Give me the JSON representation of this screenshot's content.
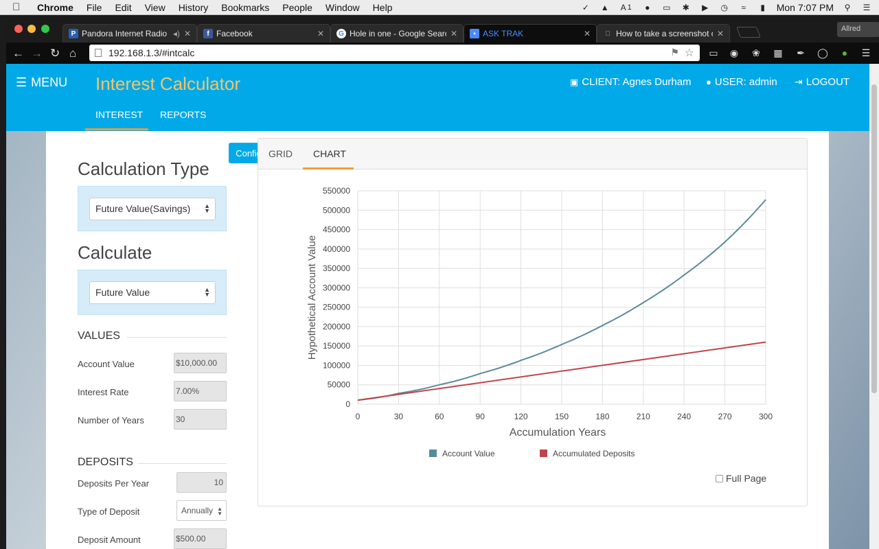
{
  "macos": {
    "menu": [
      "Chrome",
      "File",
      "Edit",
      "View",
      "History",
      "Bookmarks",
      "People",
      "Window",
      "Help"
    ],
    "clock": "Mon 7:07 PM",
    "adobe_count": "1"
  },
  "browser": {
    "tabs": [
      {
        "title": "Pandora Internet Radio",
        "favicon": "P",
        "color": "#2a5db0"
      },
      {
        "title": "Facebook",
        "favicon": "f",
        "color": "#3b5998"
      },
      {
        "title": "Hole in one - Google Search",
        "favicon": "G",
        "color": "#ffffff"
      },
      {
        "title": "ASK TRAK",
        "favicon": "chat-icon",
        "color": "#4a8cff"
      },
      {
        "title": "How to take a screenshot on",
        "favicon": "apple-icon",
        "color": "#999999"
      }
    ],
    "profile": "Allred",
    "url": "192.168.1.3/#intcalc"
  },
  "header": {
    "menu_label": "MENU",
    "title": "Interest Calculator",
    "client": "CLIENT: Agnes Durham",
    "user": "USER: admin",
    "logout": "LOGOUT",
    "nav": [
      "INTEREST",
      "REPORTS"
    ]
  },
  "left": {
    "config": "Config",
    "calc_type_title": "Calculation Type",
    "calc_type_value": "Future Value(Savings)",
    "calculate_title": "Calculate",
    "calculate_value": "Future Value",
    "values_heading": "VALUES",
    "account_value_label": "Account Value",
    "account_value": "$10,000.00",
    "interest_rate_label": "Interest Rate",
    "interest_rate": "7.00%",
    "years_label": "Number of Years",
    "years": "30",
    "deposits_heading": "DEPOSITS",
    "deposits_per_year_label": "Deposits Per Year",
    "deposits_per_year": "10",
    "type_of_deposit_label": "Type of Deposit",
    "type_of_deposit": "Annually",
    "deposit_amount_label": "Deposit Amount",
    "deposit_amount": "$500.00"
  },
  "panel": {
    "tabs": [
      "GRID",
      "CHART"
    ],
    "full_page": "Full Page"
  },
  "chart_data": {
    "type": "line",
    "xlabel": "Accumulation Years",
    "ylabel": "Hypothetical Account Value",
    "x_ticks": [
      0,
      30,
      60,
      90,
      120,
      150,
      180,
      210,
      240,
      270,
      300
    ],
    "y_ticks": [
      0,
      50000,
      100000,
      150000,
      200000,
      250000,
      300000,
      350000,
      400000,
      450000,
      500000,
      550000
    ],
    "xlim": [
      0,
      300
    ],
    "ylim": [
      0,
      550000
    ],
    "grid": true,
    "legend_position": "bottom",
    "series": [
      {
        "name": "Account Value",
        "color": "#5b8a9a",
        "x": [
          0,
          30,
          60,
          90,
          120,
          150,
          180,
          210,
          240,
          270,
          300
        ],
        "y": [
          10500,
          28000,
          50000,
          79000,
          113000,
          154000,
          203000,
          262000,
          333000,
          418000,
          527000
        ]
      },
      {
        "name": "Accumulated Deposits",
        "color": "#c0444a",
        "x": [
          0,
          300
        ],
        "y": [
          10500,
          160000
        ]
      }
    ]
  }
}
